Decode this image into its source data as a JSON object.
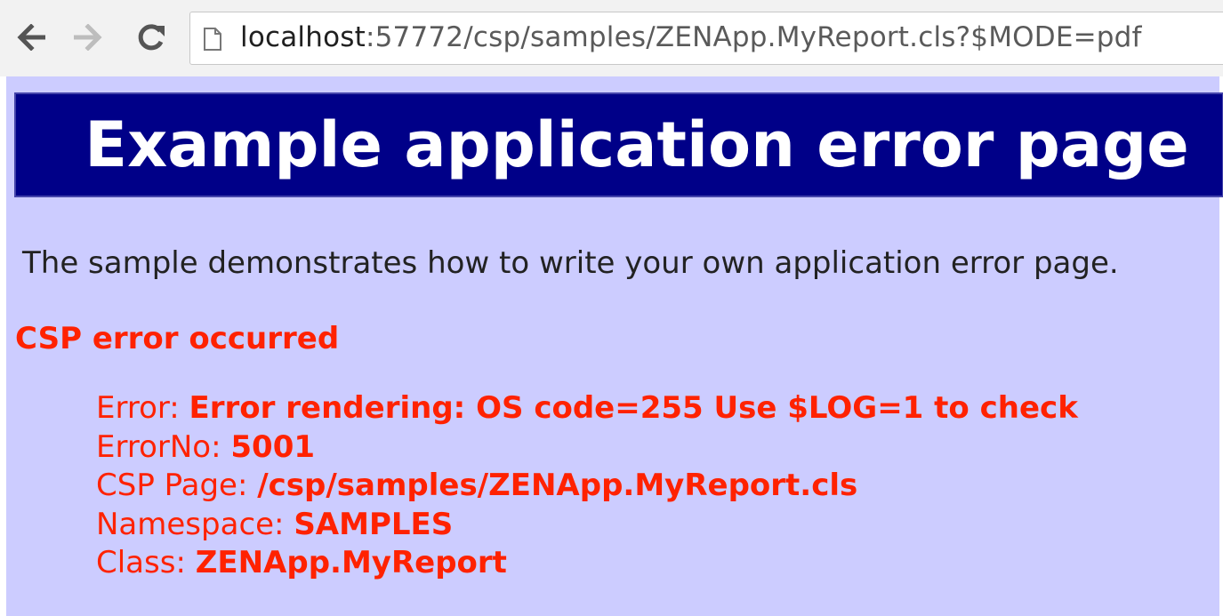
{
  "browser": {
    "url_host": "localhost",
    "url_rest": ":57772/csp/samples/ZENApp.MyReport.cls?$MODE=pdf",
    "icons": [
      "back-arrow-icon",
      "forward-arrow-icon",
      "reload-icon",
      "page-icon"
    ]
  },
  "page": {
    "title": "Example application error page",
    "intro": "The sample demonstrates how to write your own application error page.",
    "error_heading": "CSP error occurred",
    "details": [
      {
        "label": "Error: ",
        "value": "Error rendering: OS code=255 Use $LOG=1 to check"
      },
      {
        "label": "ErrorNo: ",
        "value": "5001"
      },
      {
        "label": "CSP Page: ",
        "value": "/csp/samples/ZENApp.MyReport.cls"
      },
      {
        "label": "Namespace: ",
        "value": "SAMPLES"
      },
      {
        "label": "Class: ",
        "value": "ZENApp.MyReport"
      }
    ]
  },
  "colors": {
    "page_bg": "#ccccff",
    "banner_bg": "#000088",
    "error_red": "#ff2200"
  }
}
